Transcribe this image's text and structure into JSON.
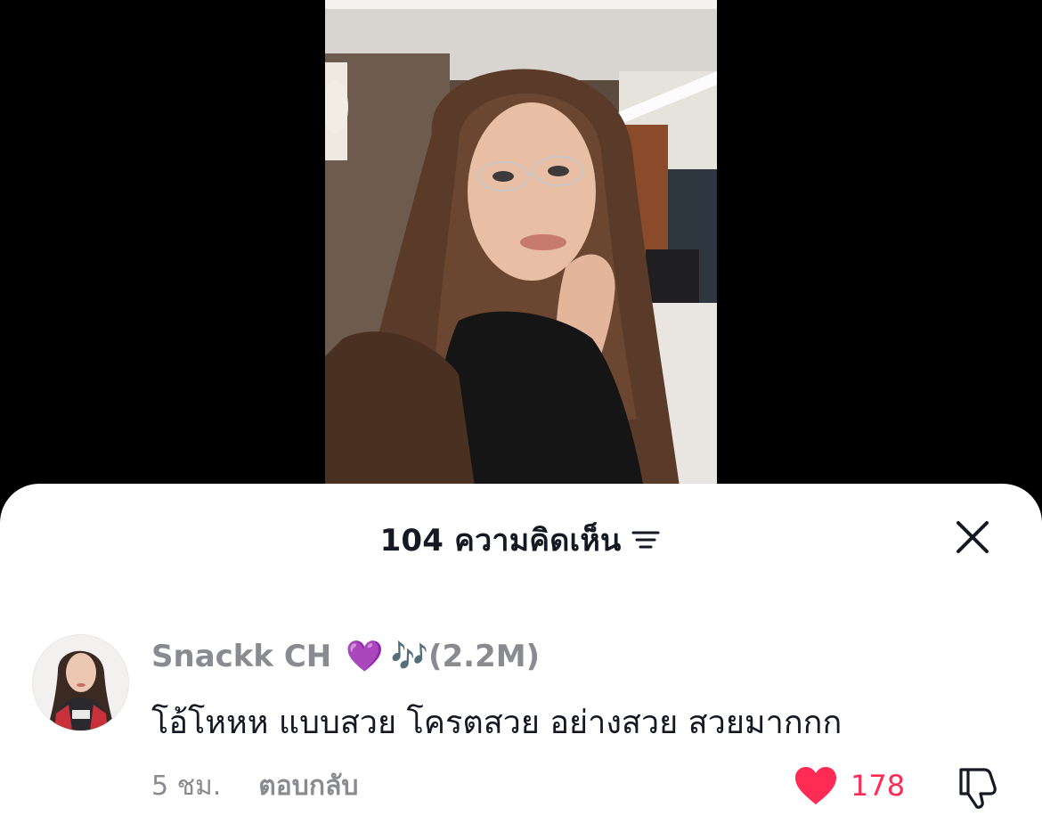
{
  "colors": {
    "accent": "#fe2c55",
    "text_primary": "#161823",
    "text_secondary": "#8a8b91",
    "sheet_bg": "#ffffff",
    "backdrop": "#000000"
  },
  "sheet": {
    "title": "104 ความคิดเห็น",
    "sort_icon": "sort-lines-icon",
    "close_icon": "close-icon"
  },
  "comments": [
    {
      "author": "Snackk CH",
      "author_emoji": "💜",
      "author_notes": "🎶",
      "author_followers": "(2.2M)",
      "text": "โอ้โหหห แบบสวย โครตสวย อย่างสวย สวยมากกก",
      "time": "5 ชม.",
      "reply_label": "ตอบกลับ",
      "like_count": "178",
      "liked": true,
      "like_icon": "heart-icon",
      "dislike_icon": "thumbs-down-icon"
    }
  ]
}
